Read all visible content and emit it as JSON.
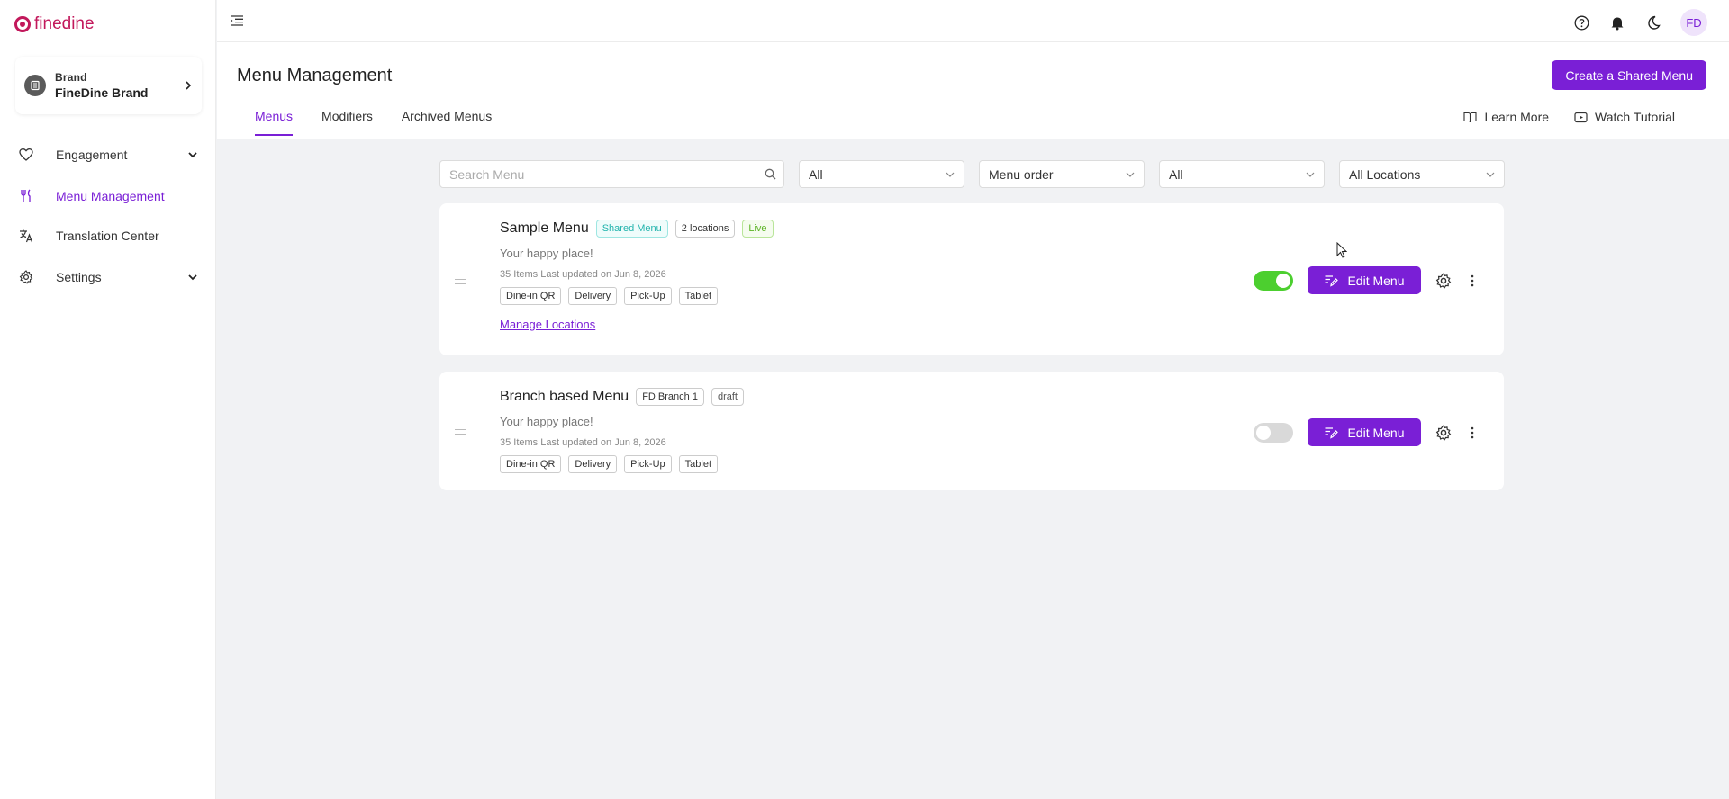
{
  "app": {
    "logo_text": "finedine"
  },
  "brand": {
    "label": "Brand",
    "name": "FineDine Brand"
  },
  "nav": {
    "items": [
      {
        "label": "Engagement",
        "icon": "heart-icon"
      },
      {
        "label": "Menu Management",
        "icon": "utensils-icon"
      },
      {
        "label": "Translation Center",
        "icon": "translate-icon"
      },
      {
        "label": "Settings",
        "icon": "gear-icon"
      }
    ]
  },
  "topbar": {
    "avatar_initials": "FD"
  },
  "header": {
    "title": "Menu Management",
    "create_label": "Create a Shared Menu",
    "tabs": [
      {
        "label": "Menus"
      },
      {
        "label": "Modifiers"
      },
      {
        "label": "Archived Menus"
      }
    ],
    "learn_more": "Learn More",
    "watch_tutorial": "Watch Tutorial"
  },
  "filters": {
    "search_placeholder": "Search Menu",
    "select_1": "All",
    "select_2": "Menu order",
    "select_3": "All",
    "select_4": "All Locations"
  },
  "menus": [
    {
      "title": "Sample Menu",
      "badges": [
        "Shared Menu",
        "2 locations",
        "Live"
      ],
      "tagline": "Your happy place!",
      "meta": "35 Items Last updated on Jun 8, 2026",
      "channels": [
        "Dine-in QR",
        "Delivery",
        "Pick-Up",
        "Tablet"
      ],
      "manage_label": "Manage Locations",
      "enabled": true,
      "edit_label": "Edit Menu"
    },
    {
      "title": "Branch based Menu",
      "badges": [
        "FD Branch 1",
        "draft"
      ],
      "tagline": "Your happy place!",
      "meta": "35 Items Last updated on Jun 8, 2026",
      "channels": [
        "Dine-in QR",
        "Delivery",
        "Pick-Up",
        "Tablet"
      ],
      "enabled": false,
      "edit_label": "Edit Menu"
    }
  ],
  "colors": {
    "accent": "#7a1fd6",
    "logo": "#c2185b",
    "toggle_on": "#4ccf2f",
    "shared_badge": "#22b4ad",
    "live_badge": "#5bb324"
  }
}
